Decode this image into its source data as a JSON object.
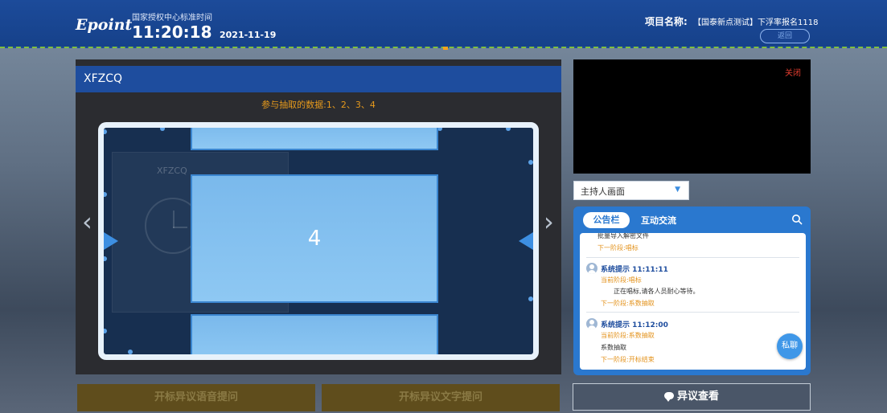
{
  "header": {
    "logo": "Epoint",
    "time_label": "国家授权中心标准时间",
    "time": "11:20:18",
    "date": "2021-11-19",
    "project_label": "项目名称:",
    "project_name": "【国泰新点测试】下浮率报名1118",
    "back_label": "返回"
  },
  "main": {
    "panel_title": "XFZCQ",
    "draw_info": "参与抽取的数据:1、2、3、4",
    "ghost_label": "XFZCQ",
    "current_number": "4",
    "nav_prev": "‹",
    "nav_next": "›",
    "voice_objection_label": "开标异议语音提问",
    "text_objection_label": "开标异议文字提问"
  },
  "sidebar": {
    "video_close_label": "关闭",
    "host_select_value": "主持人画面",
    "tabs": [
      "公告栏",
      "互动交流"
    ],
    "messages": [
      {
        "text": "批量导入解密文件",
        "next": "下一阶段:唱标"
      },
      {
        "title": "系统提示 11:11:11",
        "stage": "当前阶段:唱标",
        "text": "正在唱标,请各人员耐心等待。",
        "next": "下一阶段:系数抽取"
      },
      {
        "title": "系统提示 11:12:00",
        "stage": "当前阶段:系数抽取",
        "text": "系数抽取",
        "next": "下一阶段:开标结束"
      }
    ],
    "private_chat_label": "私聊",
    "objection_view_label": "异议查看"
  },
  "colors": {
    "header_bg": "#1c4b9a",
    "accent_blue": "#2a78cf",
    "orange_text": "#e3921b",
    "close_red": "#e43d2f"
  },
  "icons": [
    "search-icon",
    "chevron-down-icon",
    "chat-bubble-icon",
    "user-avatar-icon",
    "clock-icon",
    "arrow-left-icon",
    "arrow-right-icon"
  ]
}
